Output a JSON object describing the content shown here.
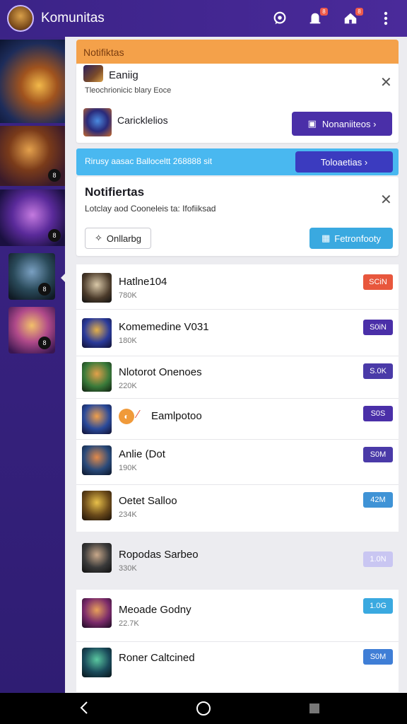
{
  "app": {
    "title": "Komunitas"
  },
  "appbar": {
    "icons": [
      "chat-icon",
      "notification-icon",
      "home-icon",
      "more-vert-icon"
    ],
    "badges": [
      "",
      "8",
      "8",
      ""
    ]
  },
  "section": {
    "title": "Notifiktas"
  },
  "card1": {
    "title": "Eaniig",
    "subtitle": "Tleochrionicic blary Eoce",
    "item_label": "Caricklelios",
    "button": "Nonaniiteos ›"
  },
  "banner": {
    "text": "Rirusy aasac Balloceltt 268888 sit",
    "button": "Toloaetias ›"
  },
  "card2": {
    "title": "Notifiertas",
    "subtitle": "Lotclay aod Cooneleis ta: Ifofiiksad",
    "button_outline": "Onllarbg",
    "button_blue": "Fetronfooty"
  },
  "list": [
    {
      "name": "Hatlne104",
      "sub": "780K",
      "badge": "SCiN",
      "color": "#e8573d"
    },
    {
      "name": "Komemedine V031",
      "sub": "180K",
      "badge": "S0iN",
      "color": "#4a2fa8"
    },
    {
      "name": "Nlotorot Onenoes",
      "sub": "220K",
      "badge": "S.0K",
      "color": "#4a3aa8"
    },
    {
      "name": "Eamlpotoo",
      "sub": "",
      "badge": "S0S",
      "color": "#4a2fa8"
    },
    {
      "name": "Anlie (Dot",
      "sub": "190K",
      "badge": "S0M",
      "color": "#4a3aa8"
    },
    {
      "name": "Oetet Salloo",
      "sub": "234K",
      "badge": "42M",
      "color": "#3f93d6"
    },
    {
      "name": "Ropodas Sarbeo",
      "sub": "330K",
      "badge": "1.0N",
      "color": "#c9c6f2"
    },
    {
      "name": "Meoade Godny",
      "sub": "22.7K",
      "badge": "1.0G",
      "color": "#3aa9e0"
    },
    {
      "name": "Roner Caltcined",
      "sub": "",
      "badge": "S0M",
      "color": "#3f7ed6"
    }
  ],
  "rail": {
    "badges": [
      "",
      "8",
      "8",
      "8",
      "8"
    ]
  }
}
